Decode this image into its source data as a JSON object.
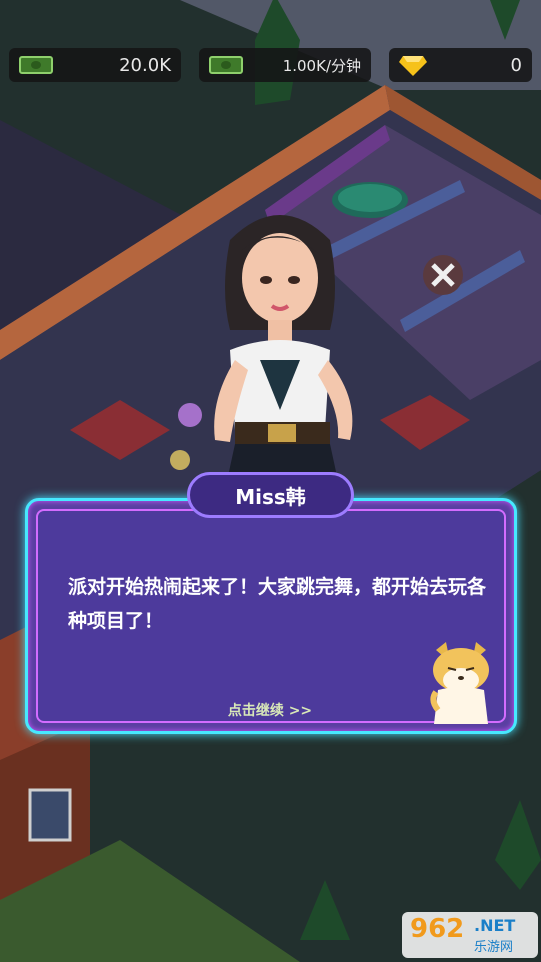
{
  "hud": {
    "cash": "20.0K",
    "income": "1.00K/分钟",
    "gems": "0",
    "cash_icon": "cash-icon",
    "income_icon": "cash-icon",
    "gem_icon": "diamond-icon"
  },
  "dialog": {
    "speaker": "Miss韩",
    "text": "派对开始热闹起来了！大家跳完舞，都开始去玩各种项目了！",
    "continue_label": "点击继续 >>",
    "accent_border": "#47e8ff",
    "panel_color": "#5a3fa2"
  },
  "watermark": {
    "number": "962",
    "net": ".NET",
    "site": "乐游网"
  }
}
